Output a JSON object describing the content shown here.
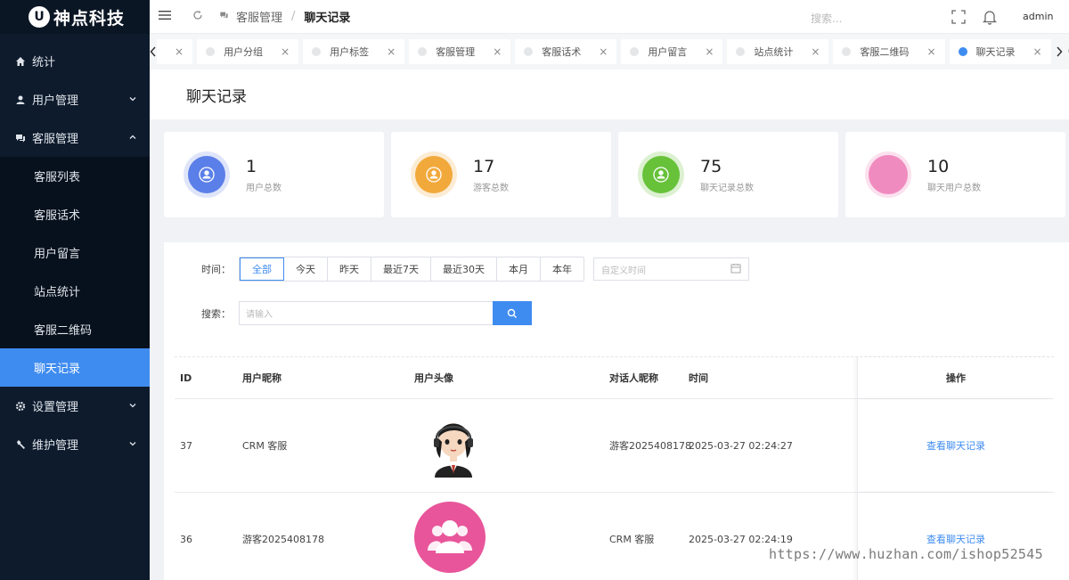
{
  "app": {
    "logo_mark": "U",
    "logo_text": "神点科技"
  },
  "sidebar": {
    "items": [
      {
        "label": "统计",
        "icon": "home-icon"
      },
      {
        "label": "用户管理",
        "icon": "user-icon"
      },
      {
        "label": "客服管理",
        "icon": "chat-icon"
      },
      {
        "label": "设置管理",
        "icon": "gear-icon"
      },
      {
        "label": "维护管理",
        "icon": "wrench-icon"
      }
    ],
    "sub_items": [
      "客服列表",
      "客服话术",
      "用户留言",
      "站点统计",
      "客服二维码",
      "聊天记录"
    ]
  },
  "header": {
    "breadcrumb_parent": "客服管理",
    "breadcrumb_sep": "/",
    "breadcrumb_current": "聊天记录",
    "search_placeholder": "搜索...",
    "user": "admin"
  },
  "tabs": [
    "用户分组",
    "用户标签",
    "客服管理",
    "客服话术",
    "用户留言",
    "站点统计",
    "客服二维码",
    "聊天记录"
  ],
  "page": {
    "title": "聊天记录"
  },
  "stats": [
    {
      "value": "1",
      "label": "用户总数",
      "color": "#5b7fe8",
      "ring": "#dfe5f9"
    },
    {
      "value": "17",
      "label": "游客总数",
      "color": "#f2a93b",
      "ring": "#fcecd4"
    },
    {
      "value": "75",
      "label": "聊天记录总数",
      "color": "#67c23a",
      "ring": "#dcf1d1"
    },
    {
      "value": "10",
      "label": "聊天用户总数",
      "color": "#f08bc0",
      "ring": "#fbe1ee"
    }
  ],
  "filter": {
    "time_label": "时间：",
    "time_options": [
      "全部",
      "今天",
      "昨天",
      "最近7天",
      "最近30天",
      "本月",
      "本年"
    ],
    "date_placeholder": "自定义时间",
    "search_label": "搜索：",
    "search_placeholder": "请输入"
  },
  "table": {
    "columns": [
      "ID",
      "用户昵称",
      "用户头像",
      "对话人昵称",
      "时间",
      "操作"
    ],
    "rows": [
      {
        "id": "37",
        "nick": "CRM 客服",
        "peer": "游客2025408178",
        "time": "2025-03-27 02:24:27",
        "action": "查看聊天记录"
      },
      {
        "id": "36",
        "nick": "游客2025408178",
        "peer": "CRM 客服",
        "time": "2025-03-27 02:24:19",
        "action": "查看聊天记录"
      }
    ]
  },
  "watermark": "https://www.huzhan.com/ishop52545"
}
